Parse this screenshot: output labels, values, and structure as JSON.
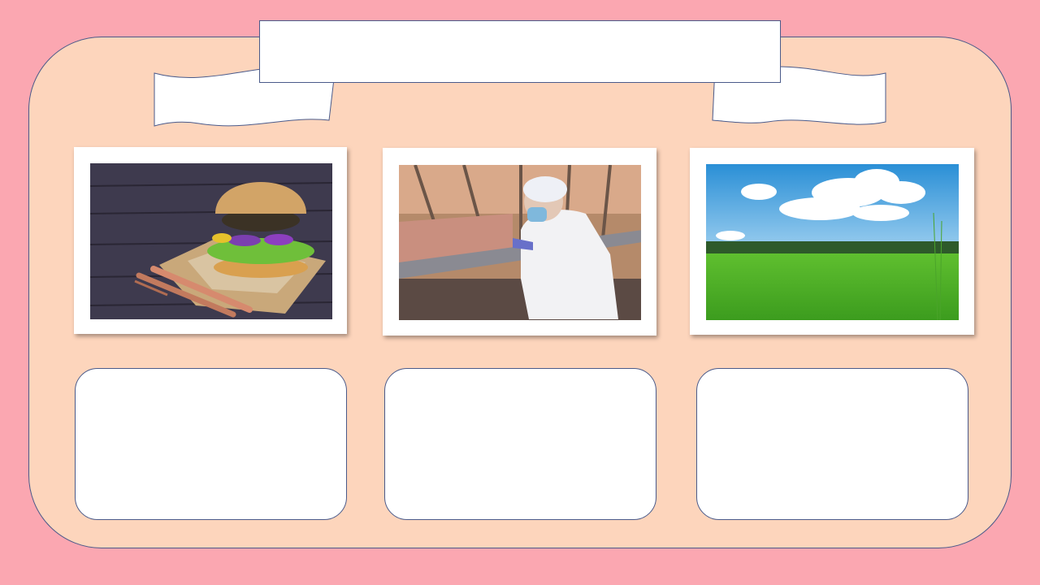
{
  "slide": {
    "colors": {
      "background": "#fba7b1",
      "panel": "#fdd5bc",
      "outline": "#4a5a8a",
      "box": "#ffffff"
    },
    "title": "",
    "photos": [
      {
        "icon": "veggie-burger-photo"
      },
      {
        "icon": "pig-farm-veterinarian-photo"
      },
      {
        "icon": "green-field-photo"
      }
    ],
    "answer_boxes": [
      "",
      "",
      ""
    ]
  }
}
